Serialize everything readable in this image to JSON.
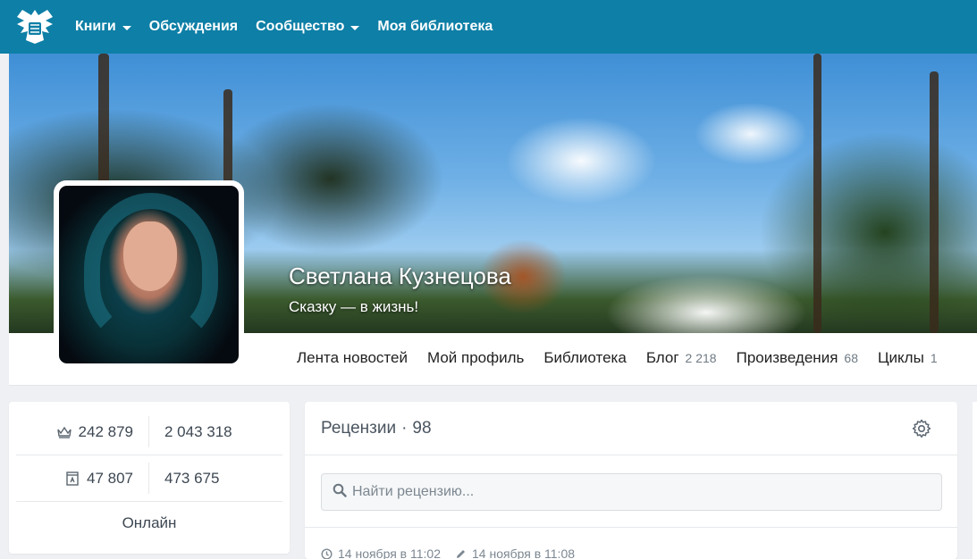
{
  "navbar": {
    "logo_icon": "eagle-logo-icon",
    "items": [
      {
        "label": "Книги",
        "has_dropdown": true
      },
      {
        "label": "Обсуждения",
        "has_dropdown": false
      },
      {
        "label": "Сообщество",
        "has_dropdown": true
      },
      {
        "label": "Моя библиотека",
        "has_dropdown": false
      }
    ],
    "color": "#0e7fa6"
  },
  "profile": {
    "name": "Светлана Кузнецова",
    "tagline": "Сказку — в жизнь!"
  },
  "tabs": [
    {
      "label": "Лента новостей",
      "count": ""
    },
    {
      "label": "Мой профиль",
      "count": ""
    },
    {
      "label": "Библиотека",
      "count": ""
    },
    {
      "label": "Блог",
      "count": "2 218"
    },
    {
      "label": "Произведения",
      "count": "68"
    },
    {
      "label": "Циклы",
      "count": "1"
    }
  ],
  "stats": {
    "row1": {
      "icon": "crown-icon",
      "left": "242 879",
      "right": "2 043 318"
    },
    "row2": {
      "icon": "book-icon",
      "left": "47 807",
      "right": "473 675"
    },
    "status": "Онлайн"
  },
  "reviews": {
    "title": "Рецензии",
    "separator": "·",
    "count": "98",
    "settings_icon": "gear-icon",
    "search_placeholder": "Найти рецензию...",
    "created": "14 ноября в 11:02",
    "edited": "14 ноября в 11:08"
  }
}
